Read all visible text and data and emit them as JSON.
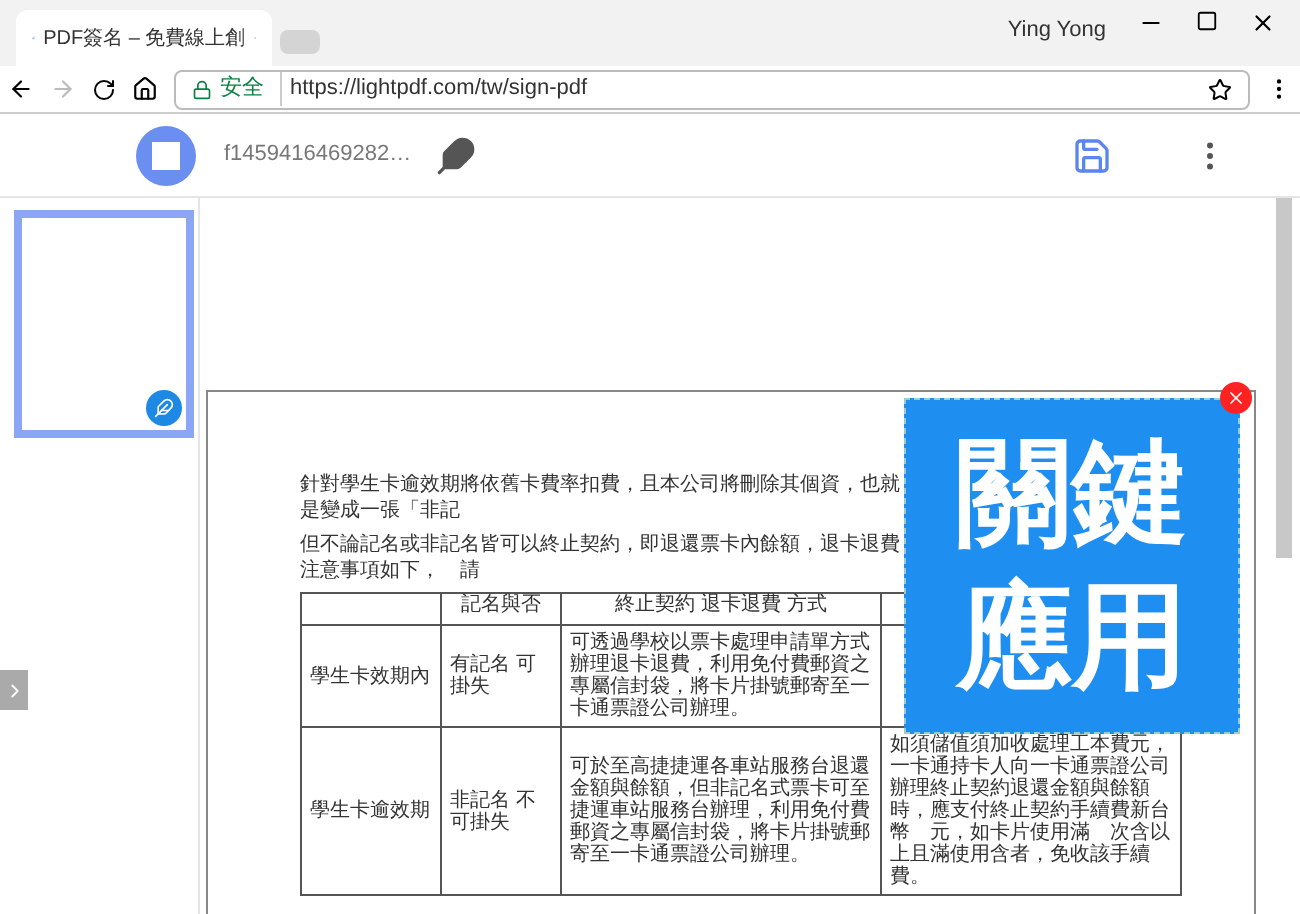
{
  "browser": {
    "tab_title": "PDF簽名 – 免費線上創",
    "user": "Ying Yong",
    "security_label": "安全",
    "url": "https://lightpdf.com/tw/sign-pdf"
  },
  "app_header": {
    "file_name": "f1459416469282…"
  },
  "thumbnails": [
    {
      "selected": true
    }
  ],
  "document": {
    "paragraphs": [
      "針對學生卡逾效期將依舊卡費率扣費，且本公司將刪除其個資，也就是變成一張「非記",
      "但不論記名或非記名皆可以終止契約，即退還票卡內餘額，退卡退費注意事項如下，　請"
    ],
    "table": {
      "columns": [
        "",
        "記名與否",
        "終止契約 退卡退費 方式",
        ""
      ],
      "rows": [
        [
          "學生卡效期內",
          "有記名 可掛失",
          "可透過學校以票卡處理申請單方式辦理退卡退費，利用免付費郵資之專屬信封袋，將卡片掛號郵寄至一卡通票證公司辦理。",
          ""
        ],
        [
          "學生卡逾效期",
          "非記名 不可掛失",
          "可於至高捷捷運各車站服務台退還金額與餘額，但非記名式票卡可至捷運車站服務台辦理，利用免付費郵資之專屬信封袋，將卡片掛號郵寄至一卡通票證公司辦理。",
          "如須儲值須加收處理工本費元，一卡通持卡人向一卡通票證公司辦理終止契約退還金額與餘額時，應支付終止契約手續費新台幣　元，如卡片使用滿　次含以上且滿使用含者，免收該手續費。"
        ]
      ]
    }
  },
  "stamp": {
    "lines": [
      "關鍵",
      "應用"
    ]
  }
}
